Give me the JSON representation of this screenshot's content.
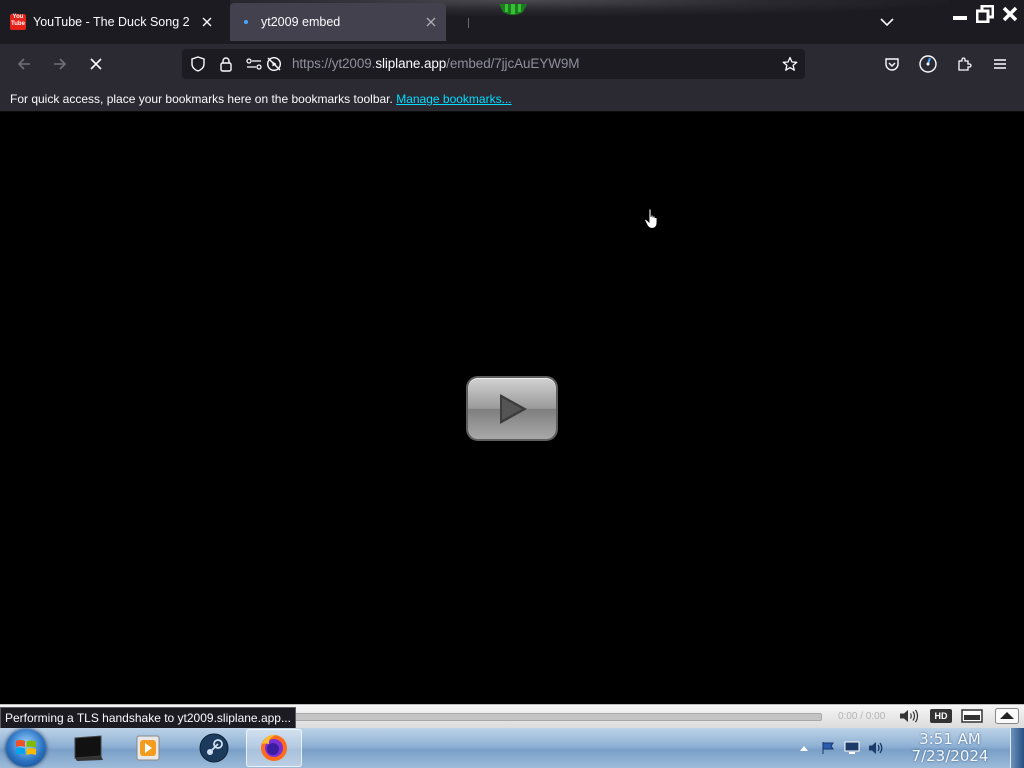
{
  "browser": {
    "tabs": [
      {
        "title": "YouTube - The Duck Song 2",
        "favicon": "youtube-favicon",
        "active": false
      },
      {
        "title": "yt2009 embed",
        "favicon": "loading-dot-favicon",
        "active": true
      }
    ],
    "youtube_favicon_text_top": "You",
    "youtube_favicon_text_bottom": "Tube",
    "url": {
      "prefix": "https://yt2009.",
      "host": "sliplane.app",
      "path": "/embed/7jjcAuEYW9M"
    },
    "bookmarks_bar": {
      "message": "For quick access, place your bookmarks here on the bookmarks toolbar.",
      "link": "Manage bookmarks..."
    },
    "status_text": "Performing a TLS handshake to yt2009.sliplane.app..."
  },
  "player": {
    "time": "0:00 / 0:00",
    "hd_label": "HD",
    "progress": 0
  },
  "taskbar": {
    "time": "3:51 AM",
    "date": "7/23/2024",
    "apps": [
      "terminal-app-icon",
      "media-player-app-icon",
      "steam-app-icon",
      "firefox-app-icon"
    ]
  },
  "colors": {
    "tab_strip": "#1c1b22",
    "toolbar": "#2b2a33",
    "active_tab": "#42414d",
    "link": "#00ddff",
    "youtube_red": "#e62117",
    "taskbar": "#8fb1d4"
  }
}
